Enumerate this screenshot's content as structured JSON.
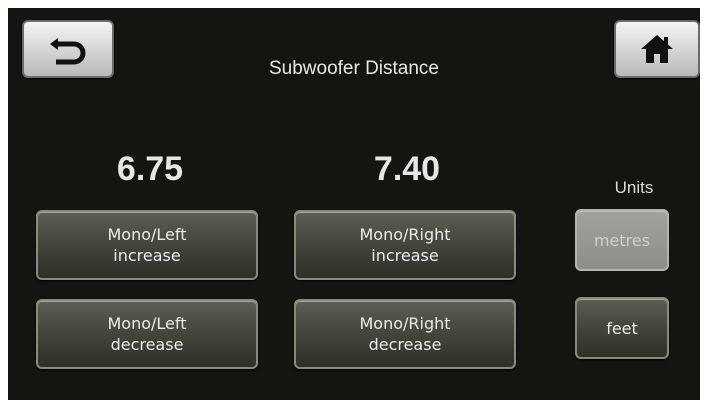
{
  "header": {
    "title": "Subwoofer Distance",
    "back_icon": "back-arrow-icon",
    "home_icon": "home-icon"
  },
  "values": {
    "left": "6.75",
    "right": "7.40"
  },
  "buttons": {
    "left_increase": [
      "Mono/Left",
      "increase"
    ],
    "right_increase": [
      "Mono/Right",
      "increase"
    ],
    "left_decrease": [
      "Mono/Left",
      "decrease"
    ],
    "right_decrease": [
      "Mono/Right",
      "decrease"
    ]
  },
  "units": {
    "label": "Units",
    "options": [
      "metres",
      "feet"
    ],
    "selected": "metres"
  }
}
